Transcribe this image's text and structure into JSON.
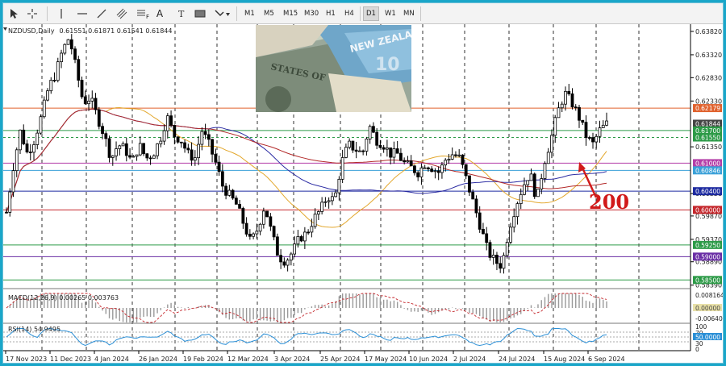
{
  "toolbar": {
    "tools": [
      "cursor-icon",
      "crosshair-icon",
      "vertical-line-icon",
      "horizontal-line-icon",
      "trendline-icon",
      "channel-icon",
      "fibonacci-icon",
      "text-icon",
      "rectangle-label-icon",
      "shapes-icon"
    ],
    "fib_label": "F",
    "text_label": "A",
    "timeframes": [
      "M1",
      "M5",
      "M15",
      "M30",
      "H1",
      "H4",
      "D1",
      "W1",
      "MN"
    ],
    "active_timeframe": "D1"
  },
  "chart_header": {
    "symbol": "NZDUSD,Daily",
    "ohlc": "0.61551 0.61871 0.61541 0.61844"
  },
  "photo": {
    "description": "currency banknotes photo",
    "text": "NEW ZEALA"
  },
  "annotation": {
    "label": "200",
    "color": "#d11a1a"
  },
  "macd": {
    "label": "MACD(12,26,9) 0.00265 0.003763",
    "scale": [
      "0.008164",
      "0.00000",
      "-0.006409"
    ],
    "zero_tag": "0.00000"
  },
  "rsi": {
    "label": "RSI(14) 54.9495",
    "scale": [
      "100",
      "70",
      "50.0000",
      "30",
      "0"
    ]
  },
  "price_scale": [
    "0.63820",
    "0.63320",
    "0.62830",
    "0.62330",
    "0.61350",
    "0.60350",
    "0.59870",
    "0.59370",
    "0.58890",
    "0.58390"
  ],
  "price_tags": [
    {
      "value": "0.62179",
      "color": "#e0622e"
    },
    {
      "value": "0.61844",
      "color": "#444444"
    },
    {
      "value": "0.61700",
      "color": "#2c9a47"
    },
    {
      "value": "0.61550",
      "color": "#2c9a47"
    },
    {
      "value": "0.61000",
      "color": "#b43ea8"
    },
    {
      "value": "0.60846",
      "color": "#3aa0d8"
    },
    {
      "value": "0.60400",
      "color": "#1d2aa0"
    },
    {
      "value": "0.60000",
      "color": "#c4262b"
    },
    {
      "value": "0.59250",
      "color": "#2c9a47"
    },
    {
      "value": "0.59000",
      "color": "#6a2ea5"
    },
    {
      "value": "0.58500",
      "color": "#2c9a47"
    }
  ],
  "date_labels": [
    "17 Nov 2023",
    "11 Dec 2023",
    "4 Jan 2024",
    "26 Jan 2024",
    "19 Feb 2024",
    "12 Mar 2024",
    "3 Apr 2024",
    "25 Apr 2024",
    "17 May 2024",
    "10 Jun 2024",
    "2 Jul 2024",
    "24 Jul 2024",
    "15 Aug 2024",
    "6 Sep 2024"
  ],
  "chart_data": {
    "type": "candlestick",
    "symbol": "NZDUSD",
    "timeframe": "Daily",
    "ylim": [
      0.5835,
      0.6394
    ],
    "x": [
      "17 Nov 2023",
      "11 Dec 2023",
      "4 Jan 2024",
      "26 Jan 2024",
      "19 Feb 2024",
      "12 Mar 2024",
      "3 Apr 2024",
      "25 Apr 2024",
      "17 May 2024",
      "10 Jun 2024",
      "2 Jul 2024",
      "24 Jul 2024",
      "15 Aug 2024",
      "6 Sep 2024"
    ],
    "close_path": [
      0.5995,
      0.6095,
      0.617,
      0.612,
      0.615,
      0.62,
      0.626,
      0.629,
      0.634,
      0.637,
      0.63,
      0.623,
      0.624,
      0.62,
      0.616,
      0.611,
      0.614,
      0.613,
      0.61,
      0.614,
      0.611,
      0.612,
      0.615,
      0.62,
      0.616,
      0.615,
      0.612,
      0.611,
      0.617,
      0.614,
      0.61,
      0.605,
      0.603,
      0.601,
      0.597,
      0.593,
      0.596,
      0.601,
      0.595,
      0.59,
      0.589,
      0.591,
      0.594,
      0.595,
      0.598,
      0.6,
      0.603,
      0.602,
      0.61,
      0.614,
      0.613,
      0.612,
      0.618,
      0.615,
      0.614,
      0.612,
      0.612,
      0.61,
      0.609,
      0.608,
      0.61,
      0.609,
      0.608,
      0.611,
      0.612,
      0.611,
      0.606,
      0.601,
      0.596,
      0.591,
      0.589,
      0.588,
      0.596,
      0.601,
      0.605,
      0.608,
      0.602,
      0.61,
      0.615,
      0.621,
      0.625,
      0.623,
      0.62,
      0.616,
      0.614,
      0.617,
      0.6184
    ],
    "levels": [
      0.62179,
      0.617,
      0.6155,
      0.61,
      0.60846,
      0.604,
      0.6,
      0.5925,
      0.59,
      0.585
    ],
    "macd": {
      "values": [
        0.00265,
        0.003763
      ]
    },
    "rsi": {
      "value": 54.9495
    },
    "annotation": "200"
  }
}
